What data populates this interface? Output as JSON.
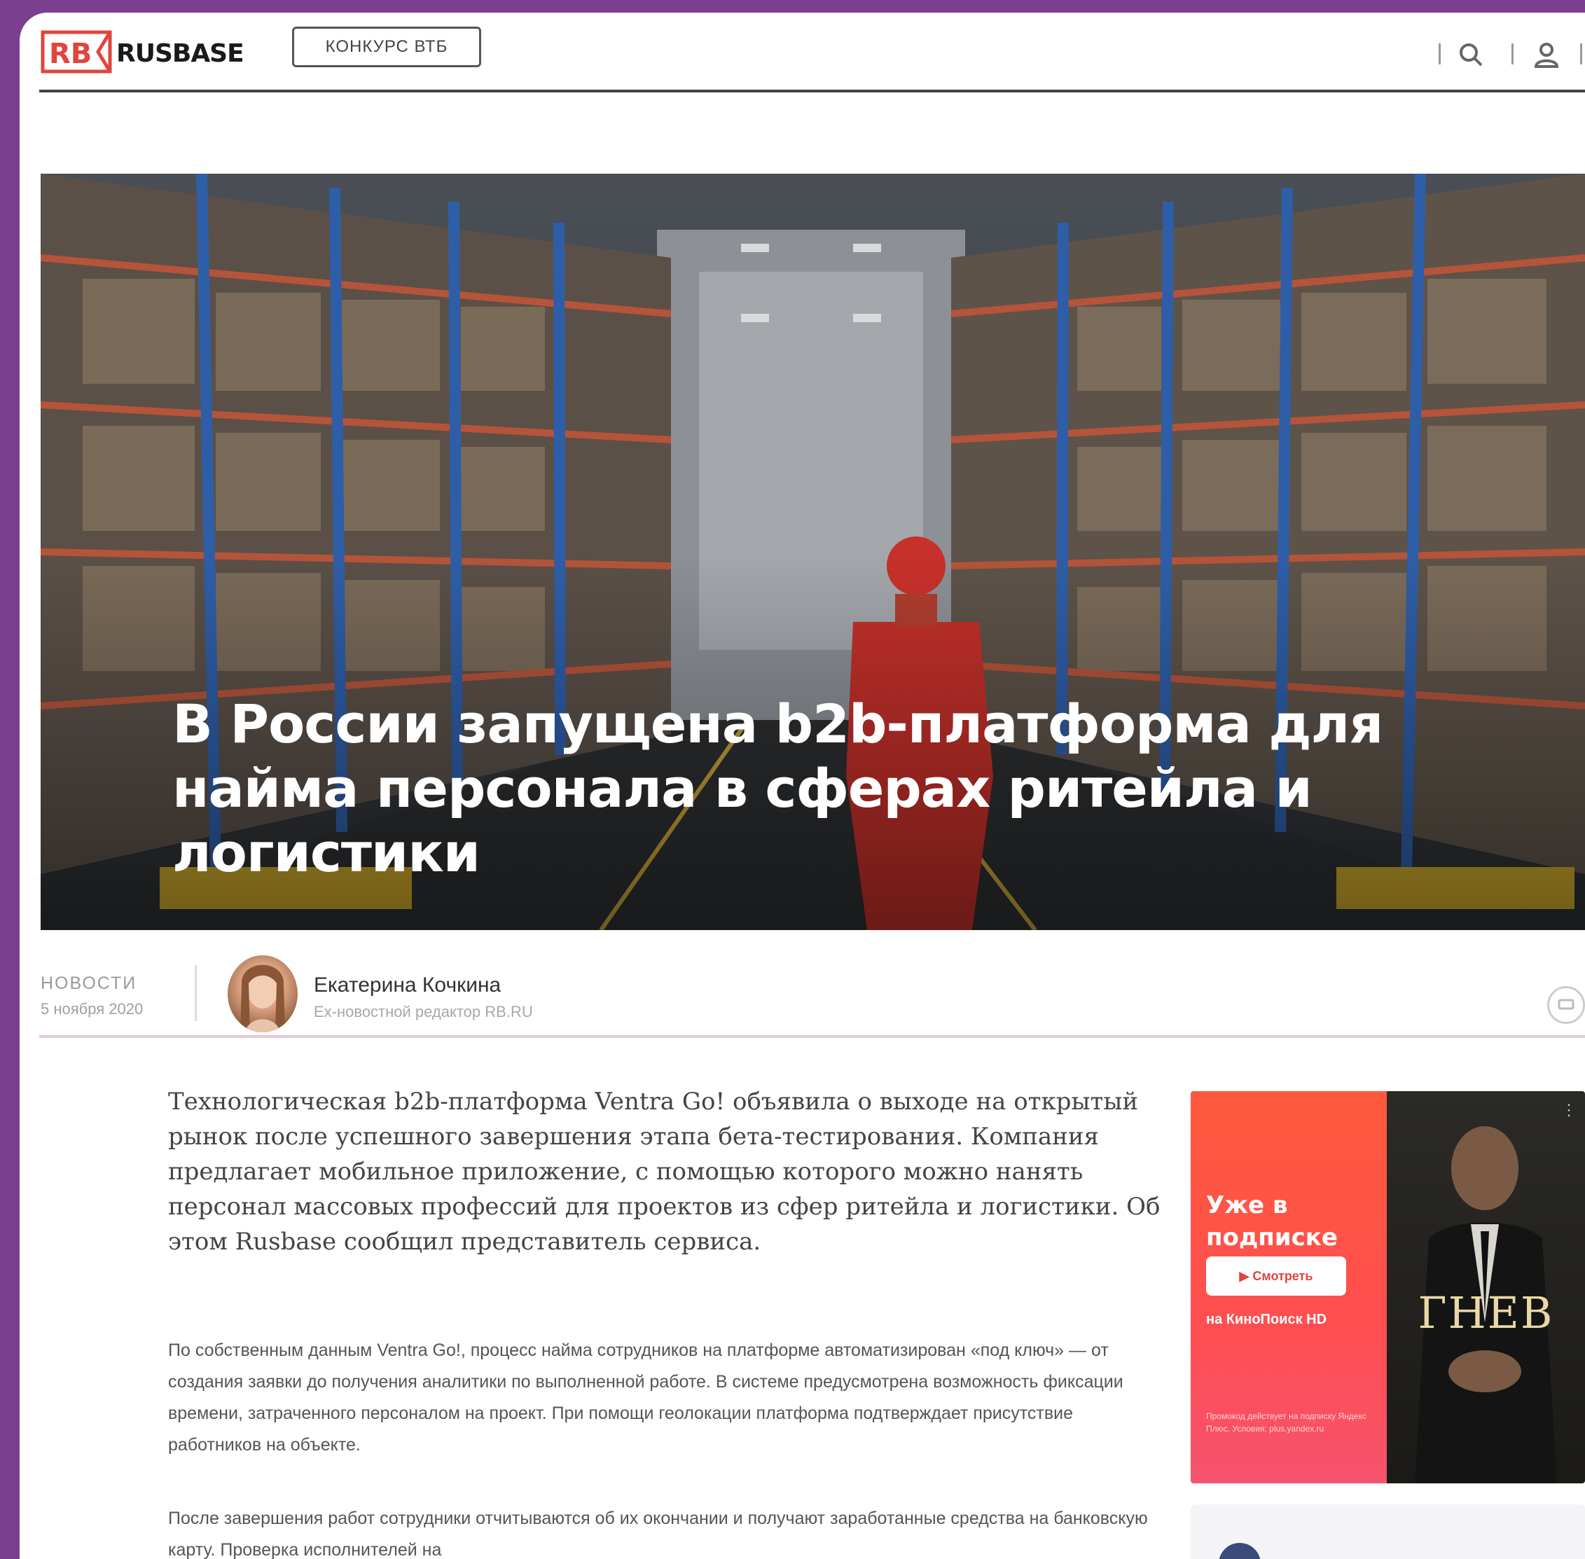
{
  "header": {
    "logo_mark": "RB",
    "logo_word": "RUSBASE",
    "contest_label": "КОНКУРС ВТБ",
    "icons": [
      "search-icon",
      "user-icon"
    ]
  },
  "hero": {
    "title": "В России запущена b2b-платформа для найма персонала в сферах ритейла и логистики"
  },
  "byline": {
    "section": "НОВОСТИ",
    "date": "5 ноября 2020",
    "author_name": "Екатерина Кочкина",
    "author_role": "Ex-новостной редактор RB.RU"
  },
  "article": {
    "lead": "Технологическая b2b-платформа Ventra Go! объявила о выходе на открытый рынок после успешного завершения этапа бета-тестирования. Компания предлагает мобильное приложение, с помощью которого можно нанять персонал массовых профессий для проектов из сфер ритейла и логистики. Об этом Rusbase сообщил представитель сервиса.",
    "paragraphs": [
      "По собственным данным Ventra Go!, процесс найма сотрудников на платформе автоматизирован «под ключ» — от создания заявки до получения аналитики по выполненной работе. В системе предусмотрена возможность фиксации времени, затраченного персоналом на проект. При помощи геолокации платформа подтверждает присутствие работников на объекте.",
      "После завершения работ сотрудники отчитываются об их окончании и получают заработанные средства на банковскую карту. Проверка исполнителей на"
    ]
  },
  "ad": {
    "headline": "Уже в подписке",
    "watch_label": "▶ Смотреть",
    "platform": "на КиноПоиск HD",
    "fine_print": "Промокод действует на подписку Яндекс Плюс. Условия: plus.yandex.ru",
    "movie_title": "ГНЕВ",
    "menu": "⋮"
  },
  "colors": {
    "frame_bg": "#7a3f8e",
    "accent": "#e0453d",
    "byline_rule": "#e6c9d6"
  }
}
